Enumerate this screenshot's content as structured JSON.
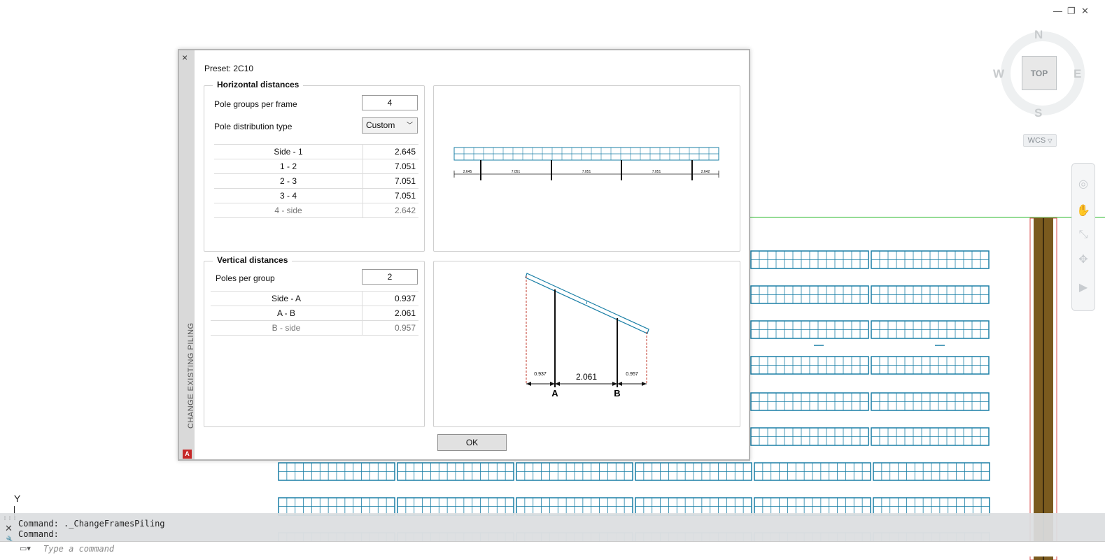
{
  "window_controls": {
    "minimize": "—",
    "restore": "❐",
    "close": "✕"
  },
  "viewcube": {
    "north": "N",
    "south": "S",
    "east": "E",
    "west": "W",
    "face": "TOP",
    "wcs_label": "WCS"
  },
  "dialog": {
    "side_title": "CHANGE EXISTING PILING",
    "close_glyph": "×",
    "logo_letter": "A",
    "preset": "Preset: 2C10",
    "horizontal": {
      "title": "Horizontal distances",
      "pole_groups_label": "Pole groups per frame",
      "pole_groups_value": "4",
      "distribution_label": "Pole distribution type",
      "distribution_value": "Custom",
      "rows": [
        {
          "k": "Side  -  1",
          "v": "2.645"
        },
        {
          "k": "1  -  2",
          "v": "7.051"
        },
        {
          "k": "2  -  3",
          "v": "7.051"
        },
        {
          "k": "3  -  4",
          "v": "7.051"
        },
        {
          "k": "4  -  side",
          "v": "2.642"
        }
      ]
    },
    "vertical": {
      "title": "Vertical distances",
      "poles_label": "Poles per group",
      "poles_value": "2",
      "rows": [
        {
          "k": "Side  -  A",
          "v": "0.937"
        },
        {
          "k": "A  -  B",
          "v": "2.061"
        },
        {
          "k": "B  -  side",
          "v": "0.957"
        }
      ]
    },
    "horizontal_preview": {
      "dims": [
        "2.645",
        "7.051",
        "7.051",
        "7.051",
        "2.642"
      ]
    },
    "vertical_preview": {
      "left": "0.937",
      "middle": "2.061",
      "right": "0.957",
      "pole_a": "A",
      "pole_b": "B"
    },
    "ok_label": "OK"
  },
  "axis_y": "Y",
  "command": {
    "line1": "Command: ._ChangeFramesPiling",
    "line2": "Command:",
    "placeholder": "Type a command"
  },
  "colors": {
    "panel": "#1a7fa6",
    "ground_line": "#2db82d",
    "post": "#7a5a1e"
  }
}
